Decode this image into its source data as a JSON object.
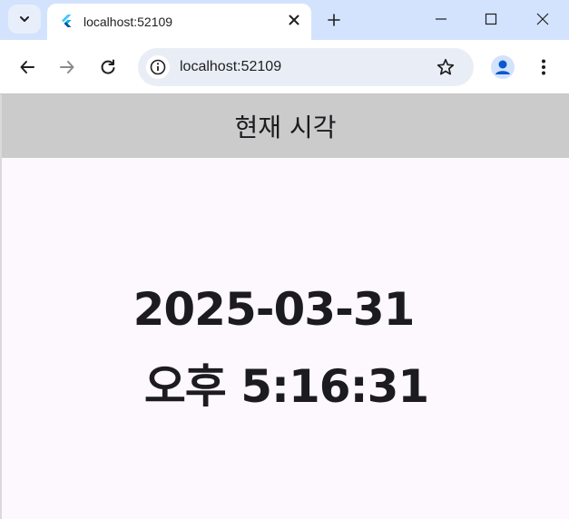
{
  "browser": {
    "tab_title": "localhost:52109",
    "address": "localhost:52109",
    "accent_color": "#d3e3fd"
  },
  "app": {
    "appbar_title": "현재 시각",
    "date": "2025-03-31",
    "time": "오후 5:16:31",
    "appbar_color": "#cbcbcb",
    "background_color": "#fdf7fe"
  }
}
